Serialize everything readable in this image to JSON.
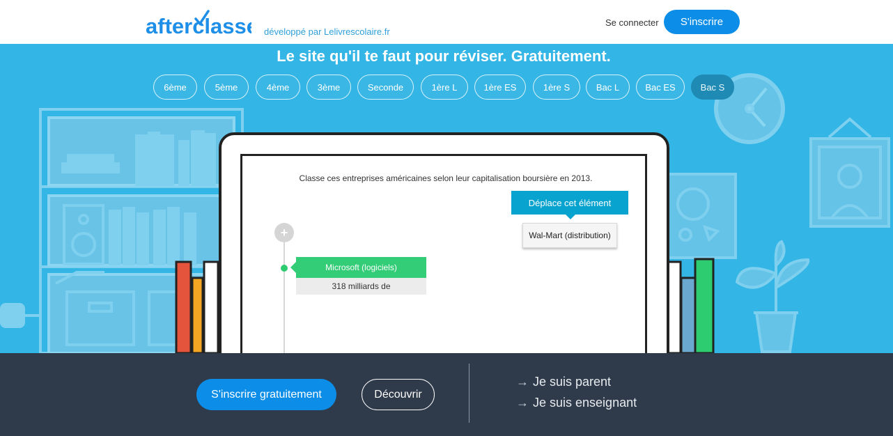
{
  "header": {
    "logo_text": "afterclasse",
    "tagline": "développé par Lelivrescolaire.fr",
    "login_label": "Se connecter",
    "signup_label": "S'inscrire"
  },
  "hero": {
    "title": "Le site qu'il te faut pour réviser. Gratuitement.",
    "levels": [
      {
        "label": "6ème",
        "active": false
      },
      {
        "label": "5ème",
        "active": false
      },
      {
        "label": "4ème",
        "active": false
      },
      {
        "label": "3ème",
        "active": false
      },
      {
        "label": "Seconde",
        "active": false
      },
      {
        "label": "1ère L",
        "active": false
      },
      {
        "label": "1ère ES",
        "active": false
      },
      {
        "label": "1ère S",
        "active": false
      },
      {
        "label": "Bac L",
        "active": false
      },
      {
        "label": "Bac ES",
        "active": false
      },
      {
        "label": "Bac S",
        "active": true
      }
    ]
  },
  "exercise": {
    "question": "Classe ces entreprises américaines selon leur capitalisation boursière en 2013.",
    "tooltip": "Déplace cet élément",
    "draggable_card": "Wal-Mart (distribution)",
    "plus_symbol": "+",
    "answer_label": "Microsoft (logiciels)",
    "answer_value": "318 milliards de"
  },
  "footer": {
    "cta_label": "S'inscrire gratuitement",
    "discover_label": "Découvrir",
    "roles": [
      {
        "label": "Je suis parent",
        "icon": "arrow-right-icon"
      },
      {
        "label": "Je suis enseignant",
        "icon": "arrow-right-icon"
      }
    ]
  },
  "colors": {
    "brand_blue": "#0c8ee8",
    "hero_bg": "#33b5e5",
    "footer_bg": "#2f3a4a",
    "green": "#33cc77",
    "tooltip": "#08a3cf"
  }
}
